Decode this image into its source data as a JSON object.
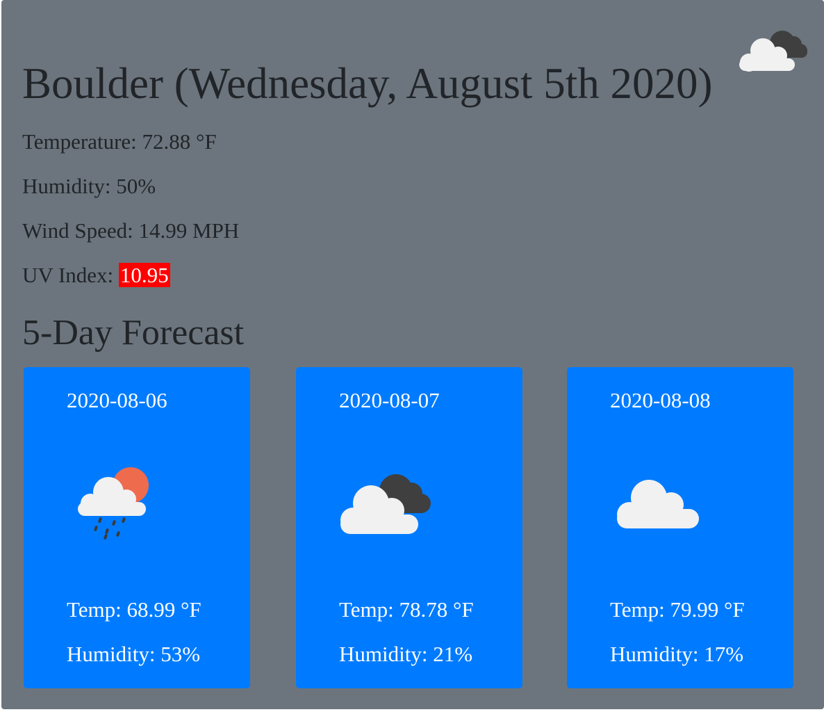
{
  "current": {
    "title": "Boulder (Wednesday, August 5th 2020)",
    "icon": "broken-clouds-icon",
    "temperature": "Temperature: 72.88 °F",
    "humidity": "Humidity: 50%",
    "wind": "Wind Speed: 14.99 MPH",
    "uv_label": "UV Index: ",
    "uv_value": "10.95",
    "uv_color": "#ff0000"
  },
  "forecast": {
    "title": "5-Day Forecast",
    "card_color": "#007bff",
    "days": [
      {
        "date": "2020-08-06",
        "icon": "rain-with-sun-icon",
        "temp": "Temp: 68.99 °F",
        "humidity": "Humidity: 53%"
      },
      {
        "date": "2020-08-07",
        "icon": "broken-clouds-icon",
        "temp": "Temp: 78.78 °F",
        "humidity": "Humidity: 21%"
      },
      {
        "date": "2020-08-08",
        "icon": "cloud-icon",
        "temp": "Temp: 79.99 °F",
        "humidity": "Humidity: 17%"
      }
    ]
  },
  "colors": {
    "panel_bg": "#6c757d",
    "text": "#212529"
  }
}
